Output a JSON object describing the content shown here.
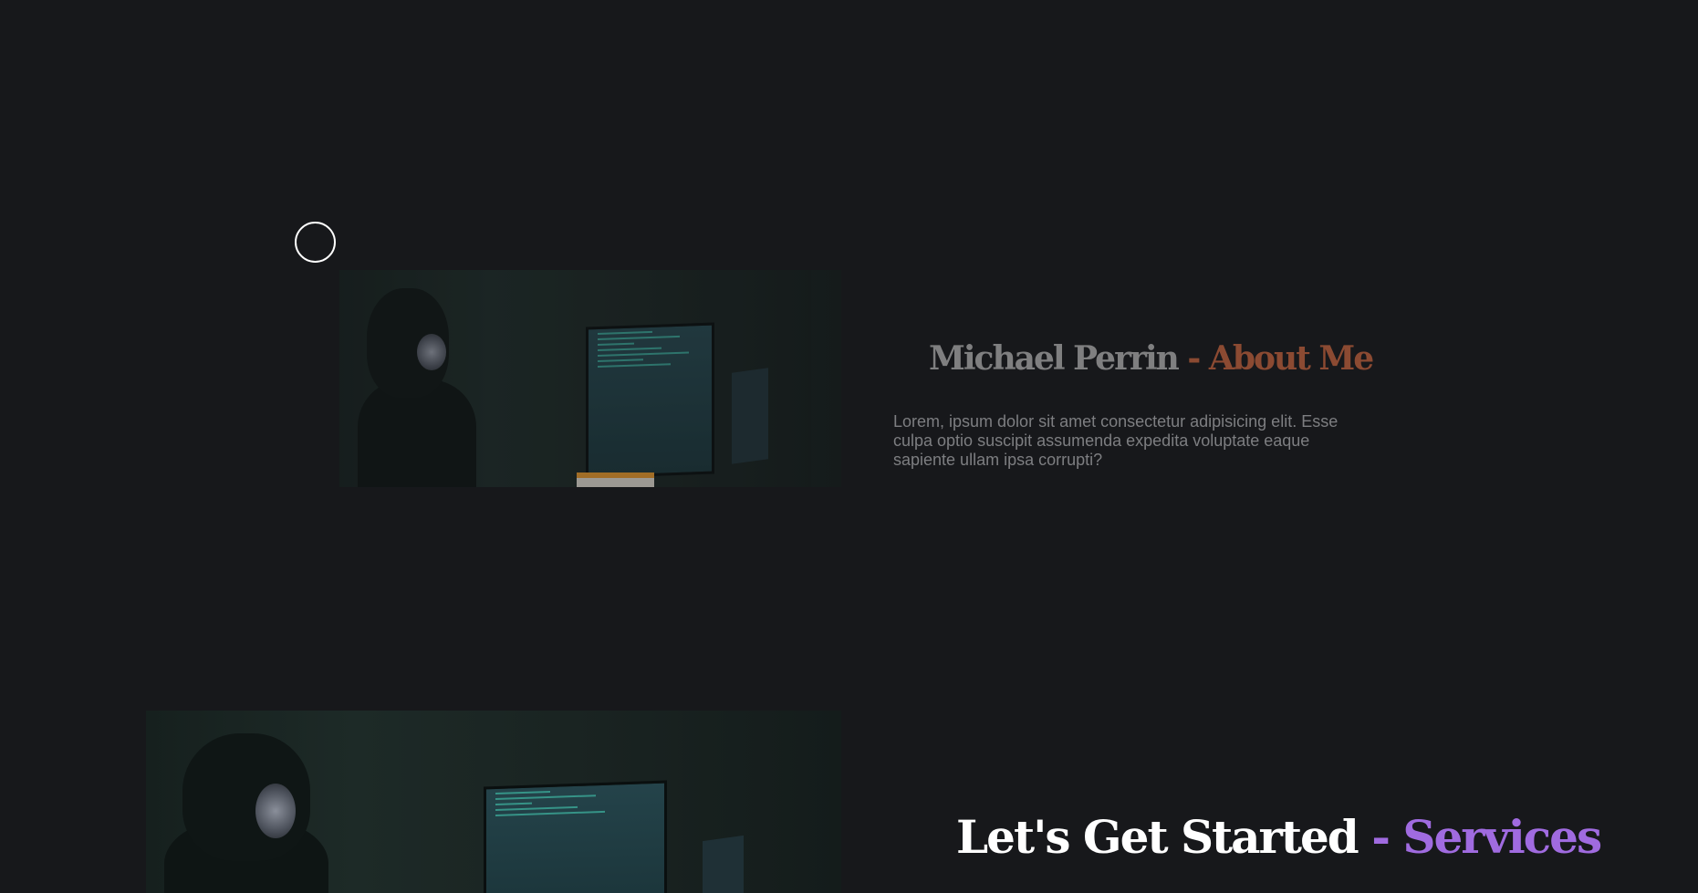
{
  "about": {
    "name": "Michael Perrin",
    "separator": "-",
    "section": "About Me",
    "text": "Lorem, ipsum dolor sit amet consectetur adipisicing elit. Esse culpa optio suscipit assumenda expedita voluptate eaque sapiente ullam ipsa corrupti?"
  },
  "services": {
    "lead": "Let's Get Started",
    "separator": "-",
    "section": "Services"
  },
  "colors": {
    "background": "#17181b",
    "about_accent": "#8b4a32",
    "services_accent": "#a06be0"
  }
}
